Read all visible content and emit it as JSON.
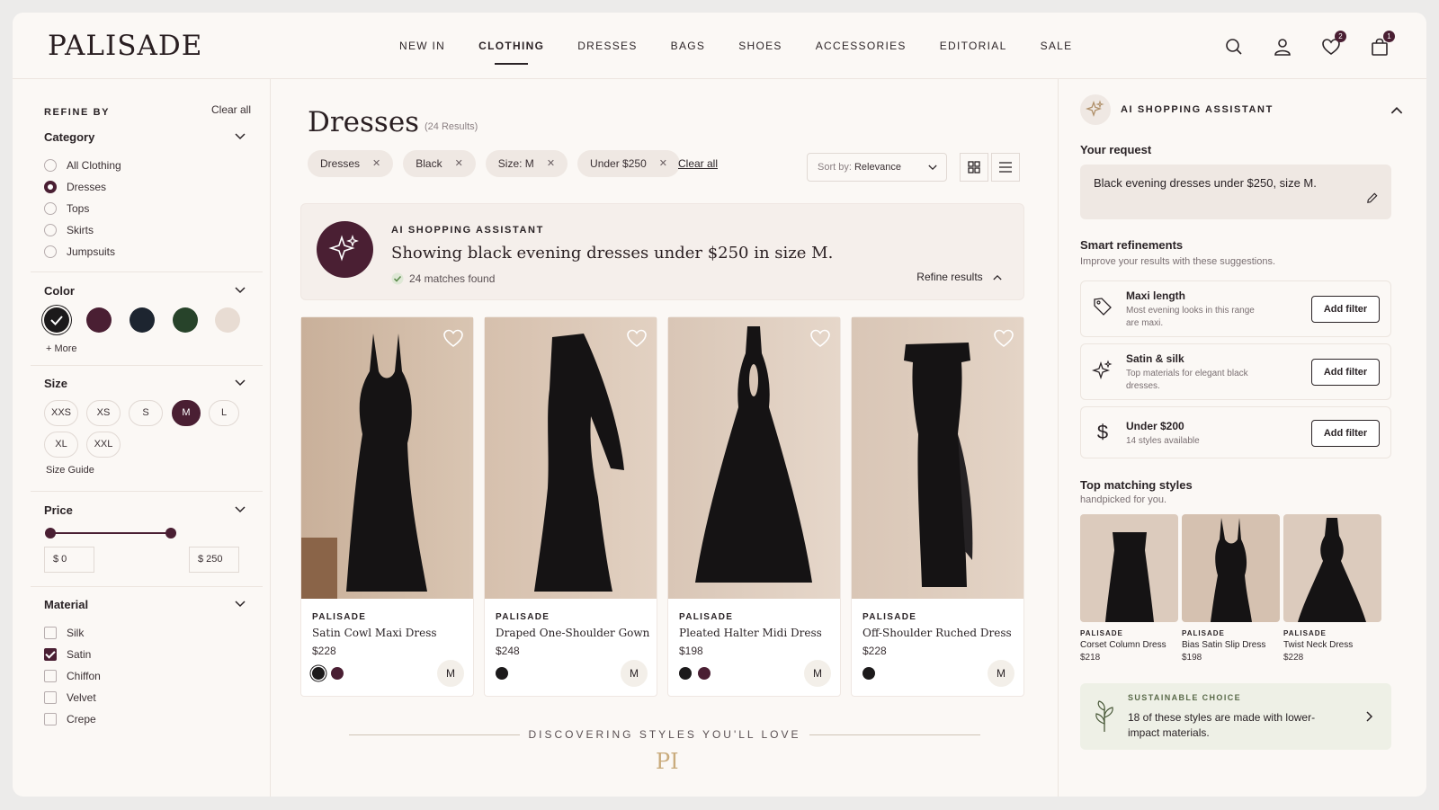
{
  "brand": "PALISADE",
  "nav": [
    "NEW IN",
    "CLOTHING",
    "DRESSES",
    "BAGS",
    "SHOES",
    "ACCESSORIES",
    "EDITORIAL",
    "SALE"
  ],
  "nav_active": "CLOTHING",
  "header_badges": {
    "wishlist": "2",
    "bag": "1"
  },
  "filters": {
    "title": "REFINE BY",
    "clear_all": "Clear all",
    "category": {
      "title": "Category",
      "options": [
        "All Clothing",
        "Dresses",
        "Tops",
        "Skirts",
        "Jumpsuits"
      ],
      "selected": "Dresses"
    },
    "color": {
      "title": "Color",
      "swatches": [
        "#1c1a1b",
        "#4a1f33",
        "#1d2530",
        "#27432a",
        "#e8dcd3"
      ],
      "selected": "#1c1a1b",
      "more": "+ More"
    },
    "size": {
      "title": "Size",
      "options": [
        "XXS",
        "XS",
        "S",
        "M",
        "L",
        "XL",
        "XXL"
      ],
      "selected": "M",
      "guide": "Size Guide"
    },
    "price": {
      "title": "Price",
      "min": "$ 0",
      "max": "$ 250",
      "range_fraction": [
        0,
        1
      ]
    },
    "material": {
      "title": "Material",
      "options": [
        "Silk",
        "Satin",
        "Chiffon",
        "Velvet",
        "Crepe"
      ],
      "checked": [
        "Satin"
      ]
    }
  },
  "page": {
    "title": "Dresses",
    "count": "(24 Results)",
    "active_chips": [
      "Dresses",
      "Black",
      "Size: M",
      "Under $250"
    ],
    "clear_all": "Clear all",
    "sort_label": "Sort by:",
    "sort_value": "Relevance"
  },
  "ai_banner": {
    "title": "AI SHOPPING ASSISTANT",
    "message": "Showing black evening dresses under $250 in size M.",
    "matches": "24 matches found",
    "refine": "Refine results"
  },
  "products": [
    {
      "brand": "PALISADE",
      "name": "Satin Cowl Maxi Dress",
      "price": "$228",
      "size": "M",
      "colors": [
        "#1c1a1b",
        "#4a1f33"
      ]
    },
    {
      "brand": "PALISADE",
      "name": "Draped One-Shoulder Gown",
      "price": "$248",
      "size": "M",
      "colors": [
        "#1c1a1b"
      ]
    },
    {
      "brand": "PALISADE",
      "name": "Pleated Halter Midi Dress",
      "price": "$198",
      "size": "M",
      "colors": [
        "#1c1a1b",
        "#4a1f33"
      ]
    },
    {
      "brand": "PALISADE",
      "name": "Off-Shoulder Ruched Dress",
      "price": "$228",
      "size": "M",
      "colors": [
        "#1c1a1b"
      ]
    }
  ],
  "footer_tagline": "DISCOVERING STYLES YOU'LL LOVE",
  "monogram": "PI",
  "assistant": {
    "title": "AI SHOPPING ASSISTANT",
    "request_label": "Your request",
    "request": "Black evening dresses under $250, size M.",
    "smart_title": "Smart refinements",
    "smart_sub": "Improve your results with these suggestions.",
    "refinements": [
      {
        "icon": "tag-icon",
        "name": "Maxi length",
        "desc": "Most evening looks in this range are maxi.",
        "action": "Add filter"
      },
      {
        "icon": "sparkle-icon",
        "name": "Satin & silk",
        "desc": "Top materials for elegant black dresses.",
        "action": "Add filter"
      },
      {
        "icon": "dollar-icon",
        "name": "Under $200",
        "desc": "14 styles available",
        "action": "Add filter"
      }
    ],
    "top_title": "Top matching styles",
    "top_sub": "handpicked for you.",
    "top_styles": [
      {
        "brand": "PALISADE",
        "name": "Corset Column Dress",
        "price": "$218"
      },
      {
        "brand": "PALISADE",
        "name": "Bias Satin Slip Dress",
        "price": "$198"
      },
      {
        "brand": "PALISADE",
        "name": "Twist Neck Dress",
        "price": "$228"
      }
    ],
    "sustainable_title": "SUSTAINABLE CHOICE",
    "sustainable_msg": "18 of these styles are made with lower-impact materials."
  },
  "accent_color": "#4a1f33"
}
